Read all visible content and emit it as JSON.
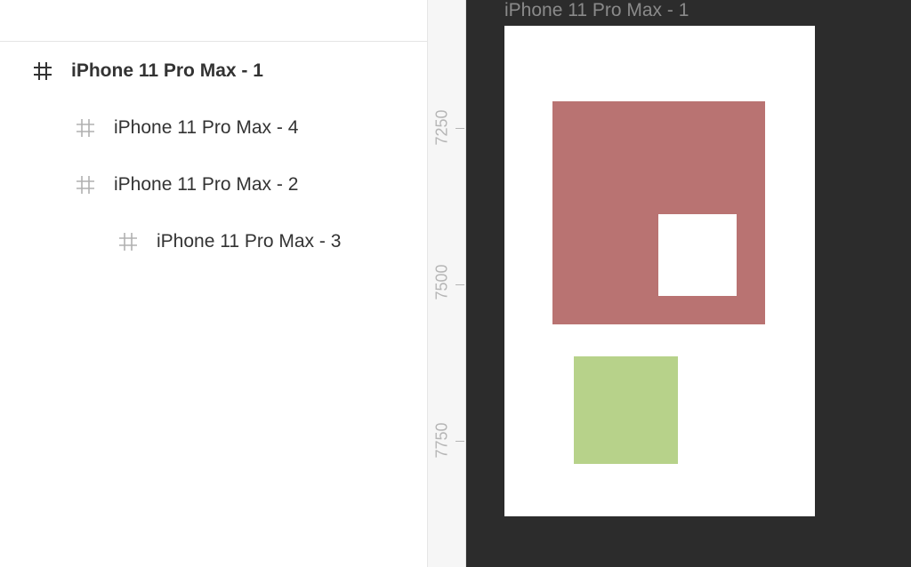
{
  "layers": {
    "items": [
      {
        "label": "iPhone 11 Pro Max - 1",
        "selected": true
      },
      {
        "label": "iPhone 11 Pro Max - 4",
        "selected": false
      },
      {
        "label": "iPhone 11 Pro Max - 2",
        "selected": false
      },
      {
        "label": "iPhone 11 Pro Max - 3",
        "selected": false
      }
    ]
  },
  "ruler": {
    "labels": [
      "7250",
      "7500",
      "7750"
    ]
  },
  "canvas": {
    "frame_title": "iPhone 11 Pro Max - 1",
    "colors": {
      "background": "#2c2c2c",
      "frame_1": "#ffffff",
      "frame_4": "#b97372",
      "frame_3": "#ffffff",
      "frame_2": "#b7d28a"
    }
  }
}
